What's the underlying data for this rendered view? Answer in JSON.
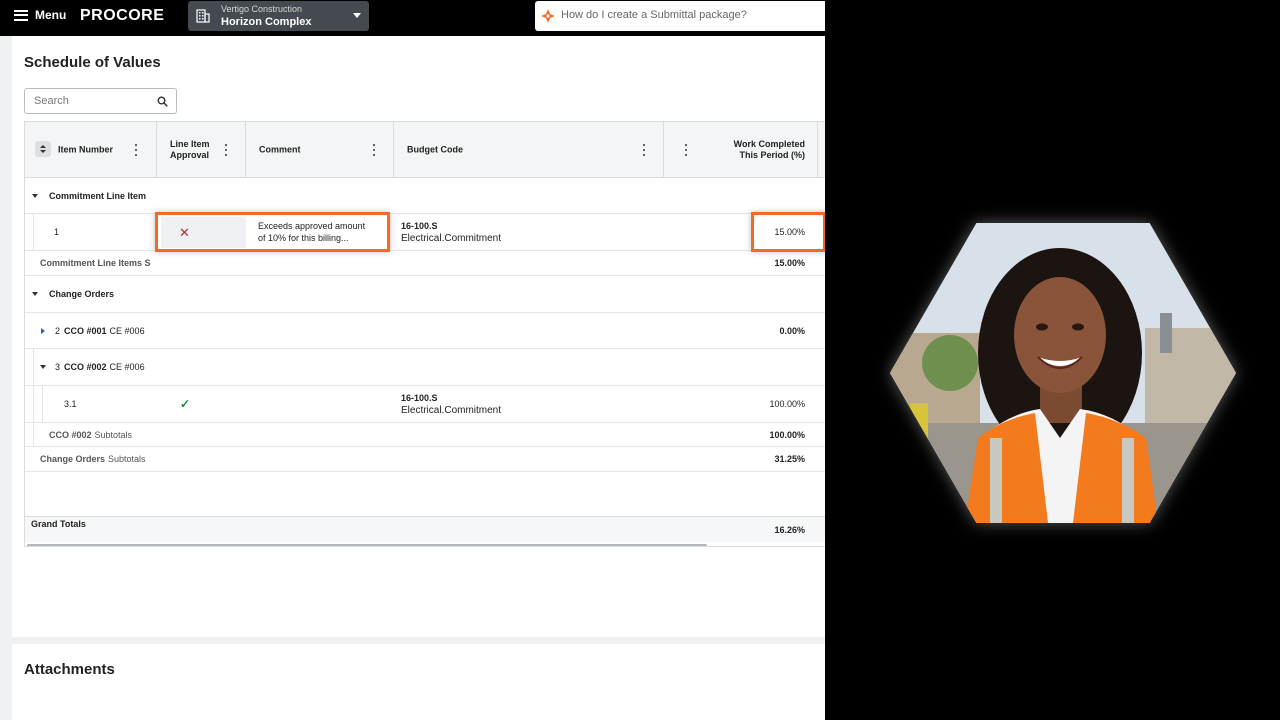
{
  "topbar": {
    "menu_label": "Menu",
    "logo_text": "PROCORE",
    "project_company": "Vertigo Construction",
    "project_name": "Horizon Complex",
    "help_placeholder": "How do I create a Submittal package?"
  },
  "sov": {
    "title": "Schedule of Values",
    "search_placeholder": "Search",
    "columns": {
      "item_number": "Item Number",
      "line_item_approval": [
        "Line Item",
        "Approval"
      ],
      "comment": "Comment",
      "budget_code": "Budget Code",
      "work_completed": [
        "Work Completed",
        "This Period (%)"
      ]
    },
    "groups": {
      "commitment": {
        "label": "Commitment Line Item",
        "row": {
          "item": "1",
          "approval": "✕",
          "comment": [
            "Exceeds approved amount",
            "of 10% for this billing..."
          ],
          "code": "16-100.S",
          "code_desc": "Electrical.Commitment",
          "pct": "15.00%"
        },
        "subtotal_label": "Commitment Line Items S",
        "subtotal_pct": "15.00%"
      },
      "change_orders": {
        "label": "Change Orders",
        "cco1": {
          "num": "2",
          "name": "CCO #001",
          "ce": "CE #006",
          "pct": "0.00%"
        },
        "cco2": {
          "num": "3",
          "name": "CCO #002",
          "ce": "CE #006"
        },
        "cco2_row": {
          "item": "3.1",
          "approval": "✓",
          "code": "16-100.S",
          "code_desc": "Electrical.Commitment",
          "pct": "100.00%"
        },
        "cco2_subtotal_name": "CCO #002",
        "cco2_subtotal_word": "Subtotals",
        "cco2_subtotal_pct": "100.00%",
        "subtotal_name": "Change Orders",
        "subtotal_word": "Subtotals",
        "subtotal_pct": "31.25%"
      }
    },
    "grand_totals_label": "Grand Totals",
    "grand_totals_pct": "16.26%"
  },
  "attachments": {
    "title": "Attachments"
  },
  "colors": {
    "highlight": "#f26a25",
    "reject_icon": "#c0262d",
    "approve_icon": "#1a8a3a",
    "expand_caret": "#2066c7"
  },
  "presenter": {
    "shape": "hexagon",
    "subject": "smiling woman in orange high-visibility safety vest at construction site"
  }
}
